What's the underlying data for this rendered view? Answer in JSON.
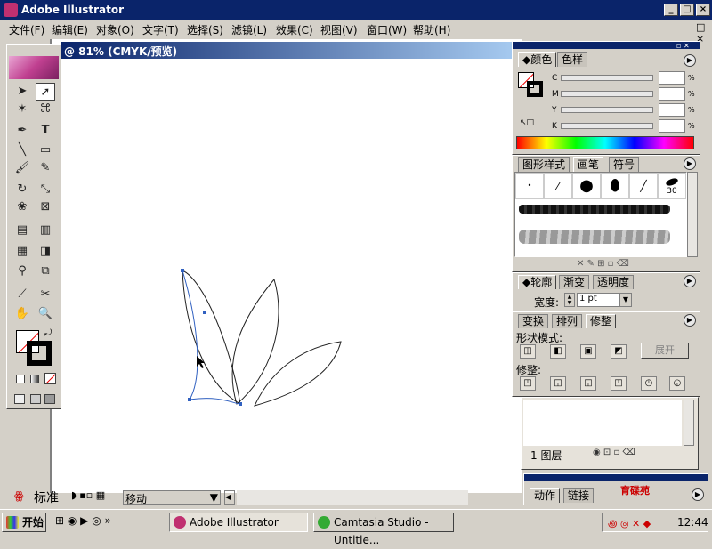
{
  "app": {
    "title": "Adobe Illustrator"
  },
  "menu": [
    "文件(F)",
    "编辑(E)",
    "对象(O)",
    "文字(T)",
    "选择(S)",
    "滤镜(L)",
    "效果(C)",
    "视图(V)",
    "窗口(W)",
    "帮助(H)"
  ],
  "document": {
    "title": "@ 81% (CMYK/预览)"
  },
  "color_panel": {
    "tabs": [
      "颜色",
      "色样"
    ],
    "channels": [
      "C",
      "M",
      "Y",
      "K"
    ],
    "unit": "%"
  },
  "brush_panel": {
    "tabs": [
      "图形样式",
      "画笔",
      "符号"
    ],
    "size_label": "30"
  },
  "stroke_panel": {
    "tabs": [
      "轮廓",
      "渐变",
      "透明度"
    ],
    "weight_label": "宽度:",
    "weight_value": "1 pt"
  },
  "pathfinder_panel": {
    "tabs": [
      "变换",
      "排列",
      "修整"
    ],
    "shape_modes_label": "形状模式:",
    "expand_label": "展开",
    "pathfinders_label": "修整:"
  },
  "layers_panel": {
    "count_label": "1 图层"
  },
  "actions_panel": {
    "tabs": [
      "动作",
      "链接"
    ]
  },
  "status": {
    "zoom": "标准",
    "tool_status": "移动"
  },
  "taskbar": {
    "start": "开始",
    "tasks": [
      "Adobe Illustrator",
      "Camtasia Studio - Untitle..."
    ],
    "clock": "12:44"
  },
  "watermark": {
    "text": "育碟苑"
  },
  "colors": {
    "title_bar": "#0a246a",
    "face": "#d4d0c8"
  }
}
